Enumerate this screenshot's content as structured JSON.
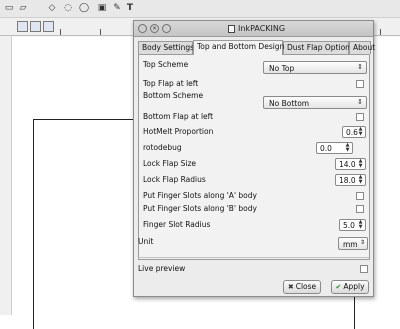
{
  "dialog": {
    "title": "InkPACKING",
    "tabs": [
      {
        "label": "Body Settings",
        "active": false
      },
      {
        "label": "Top and Bottom Design",
        "active": true
      },
      {
        "label": "Dust Flap Options",
        "active": false
      },
      {
        "label": "About",
        "active": false
      }
    ],
    "fields": {
      "top_scheme": {
        "label": "Top Scheme",
        "value": "No Top"
      },
      "top_flap_left": {
        "label": "Top Flap at left",
        "checked": false
      },
      "bottom_scheme": {
        "label": "Bottom Scheme",
        "value": "No Bottom"
      },
      "bottom_flap_left": {
        "label": "Bottom Flap at left",
        "checked": false
      },
      "hotmelt": {
        "label": "HotMelt Proportion",
        "value": "0.6"
      },
      "rotodebug": {
        "label": "rotodebug",
        "value": "0.0"
      },
      "lock_flap_size": {
        "label": "Lock Flap Size",
        "value": "14.0"
      },
      "lock_flap_radius": {
        "label": "Lock Flap Radius",
        "value": "18.0"
      },
      "finger_a": {
        "label": "Put Finger Slots along 'A' body",
        "checked": false
      },
      "finger_b": {
        "label": "Put Finger Slots along 'B' body",
        "checked": false
      },
      "finger_radius": {
        "label": "Finger Slot Radius",
        "value": "5.0"
      }
    },
    "unit": {
      "label": "Unit",
      "value": "mm"
    },
    "live_preview": {
      "label": "Live preview",
      "checked": false
    },
    "buttons": {
      "close": "Close",
      "apply": "Apply"
    }
  },
  "icons": {
    "up_down": "⇕",
    "window_close": "×"
  },
  "colors": {
    "dialog_bg": "#ececec",
    "panel_bg": "#f2f2f2",
    "apply_check": "#2f8a2f"
  }
}
